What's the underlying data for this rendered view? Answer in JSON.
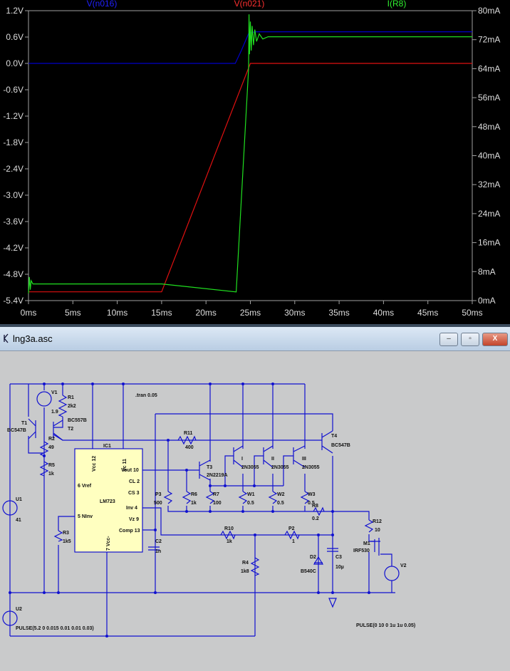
{
  "plot": {
    "traces": [
      {
        "name": "V(n016)",
        "color": "#0000c8"
      },
      {
        "name": "V(n021)",
        "color": "#e01010"
      },
      {
        "name": "I(R8)",
        "color": "#20e020"
      }
    ],
    "chart_data": {
      "type": "line",
      "x_ticks": [
        "0ms",
        "5ms",
        "10ms",
        "15ms",
        "20ms",
        "25ms",
        "30ms",
        "35ms",
        "40ms",
        "45ms",
        "50ms"
      ],
      "y_left_ticks": [
        "1.2V",
        "0.6V",
        "0.0V",
        "-0.6V",
        "-1.2V",
        "-1.8V",
        "-2.4V",
        "-3.0V",
        "-3.6V",
        "-4.2V",
        "-4.8V",
        "-5.4V"
      ],
      "y_right_ticks": [
        "80mA",
        "72mA",
        "64mA",
        "56mA",
        "48mA",
        "40mA",
        "32mA",
        "24mA",
        "16mA",
        "8mA",
        "0mA"
      ],
      "xlim": [
        0,
        50
      ],
      "ylim_left": [
        -5.4,
        1.2
      ],
      "ylim_right": [
        0,
        80
      ],
      "series": [
        {
          "name": "V(n016)",
          "axis": "left",
          "points": [
            [
              0,
              0
            ],
            [
              23.3,
              0
            ],
            [
              24,
              0.3
            ],
            [
              24.8,
              0.68
            ],
            [
              25.5,
              0.72
            ],
            [
              50,
              0.72
            ]
          ]
        },
        {
          "name": "V(n021)",
          "axis": "left",
          "points": [
            [
              0,
              -5.2
            ],
            [
              15,
              -5.2
            ],
            [
              25,
              0
            ],
            [
              50,
              0
            ]
          ]
        },
        {
          "name": "I(R8)",
          "axis": "right",
          "points": [
            [
              0,
              2
            ],
            [
              0.1,
              6.5
            ],
            [
              0.2,
              3
            ],
            [
              0.3,
              5.5
            ],
            [
              0.5,
              4.6
            ],
            [
              15,
              4.6
            ],
            [
              23.4,
              2.4
            ],
            [
              24.8,
              64
            ],
            [
              24.85,
              79
            ],
            [
              24.9,
              68
            ],
            [
              25,
              77
            ],
            [
              25.1,
              69
            ],
            [
              25.2,
              75.8
            ],
            [
              25.35,
              70.5
            ],
            [
              25.5,
              74.8
            ],
            [
              25.7,
              71.5
            ],
            [
              26,
              73.6
            ],
            [
              26.4,
              72.2
            ],
            [
              27,
              72.8
            ],
            [
              50,
              72.8
            ]
          ]
        }
      ]
    }
  },
  "window": {
    "title": "lng3a.asc",
    "minimize": "–",
    "maximize": "▫",
    "close": "X"
  },
  "schematic": {
    "directive": ".tran 0.05",
    "labels": {
      "V1": "V1",
      "V1v": "1.9",
      "R1": "R1",
      "R1v": "2k2",
      "T1": "T1",
      "T1m": "BC547B",
      "T2": "T2",
      "T2m": "BC557B",
      "R2": "R2",
      "R2v": "49",
      "R5": "R5",
      "R5v": "1k",
      "U1": "U1",
      "U1v": "41",
      "U2": "U2",
      "U2v": "PULSE(5.2 0 0.015 0.01 0.01 0.03)",
      "IC1": "IC1",
      "IC1m": "LM723",
      "vcc": "Vcc 12",
      "vc": "Vc 11",
      "vout": "Vout 10",
      "cl": "CL 2",
      "cs": "CS 3",
      "inv": "Inv 4",
      "vz": "Vz 9",
      "comp": "Comp 13",
      "vref": "6 Vref",
      "ninv": "5 NInv",
      "vee": "7 Vcc-",
      "R3": "R3",
      "R3v": "1k5",
      "C2": "C2",
      "C2v": "1n",
      "R11": "R11",
      "R11v": "400",
      "P3": "P3",
      "P3v": "500",
      "R6": "R6",
      "R6v": "1k",
      "R7": "R7",
      "R7v": "100",
      "T3": "T3",
      "T3m": "2N2219A",
      "QI": "I",
      "QII": "II",
      "QIII": "III",
      "Qm1": "2N3055",
      "Qm2": "2N3055",
      "Qm3": "2N3055",
      "W1": "W1",
      "W1v": "0.5",
      "W2": "W2",
      "W2v": "0.5",
      "W3": "W3",
      "W3v": "0.5",
      "R8": "R8",
      "R8v": "0.2",
      "T4": "T4",
      "T4m": "BC547B",
      "R10": "R10",
      "R10v": "1k",
      "P2": "P2",
      "P2v": "1",
      "R4": "R4",
      "R4v": "1k8",
      "D2": "D2",
      "D2m": "B540C",
      "C3": "C3",
      "C3v": "10µ",
      "R12": "R12",
      "R12v": "10",
      "M1": "M1",
      "M1m": "IRF530",
      "V2": "V2",
      "V2v": "PULSE(0 10 0 1u 1u 0.05)"
    }
  }
}
